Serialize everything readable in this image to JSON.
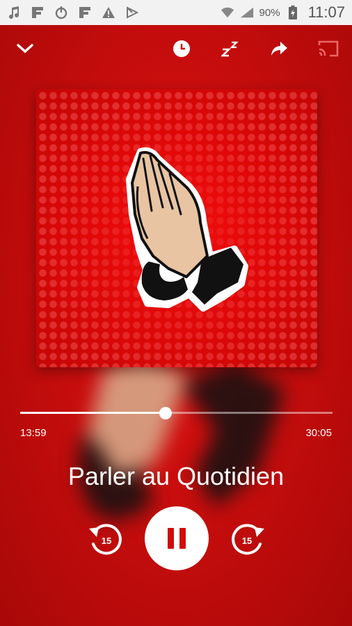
{
  "status_bar": {
    "battery_percent": "90%",
    "time": "11:07"
  },
  "toolbar": {
    "collapse_icon": "chevron-down-icon",
    "sleep_timer_icon": "clock-icon",
    "sleep_icon": "zzz-icon",
    "share_icon": "share-arrow-icon",
    "cast_icon": "cast-icon"
  },
  "player": {
    "elapsed": "13:59",
    "total": "30:05",
    "progress": 0.465,
    "title": "Parler au Quotidien",
    "rewind_seconds": "15",
    "forward_seconds": "15"
  },
  "colors": {
    "background": "#c40a0a",
    "accent": "#d10b0b"
  }
}
